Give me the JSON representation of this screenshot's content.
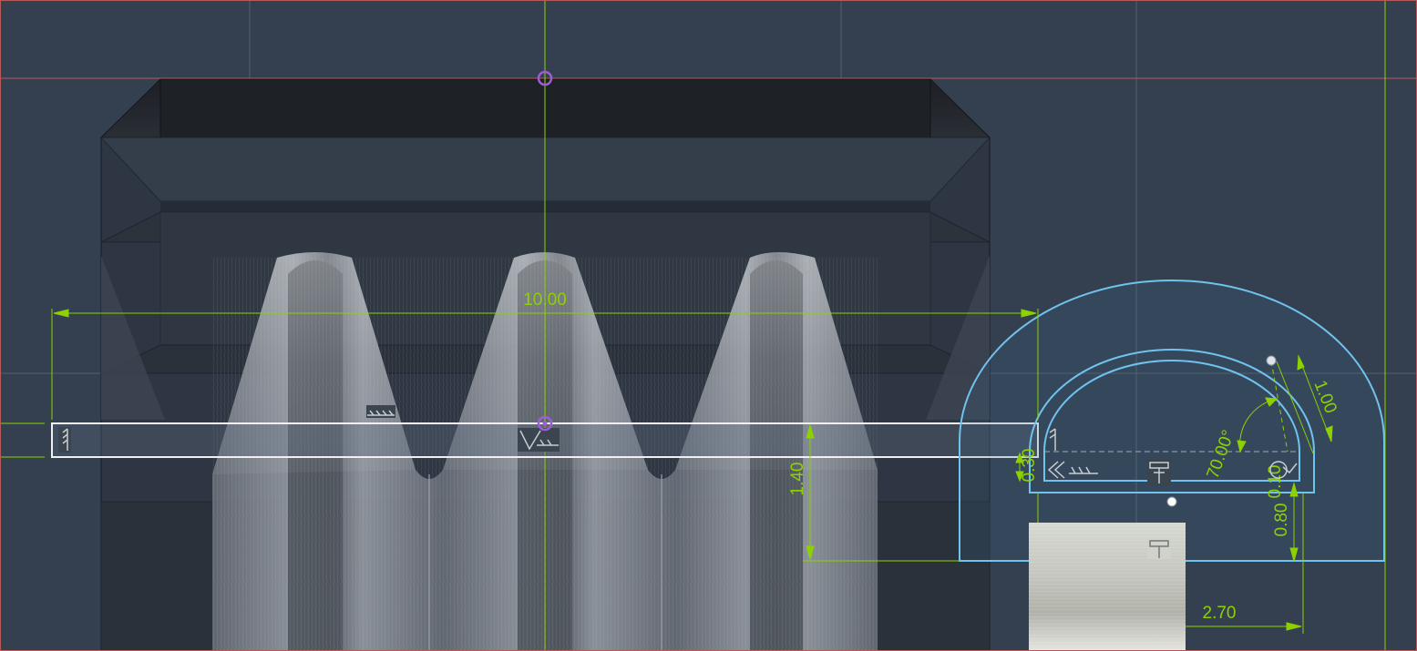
{
  "viewport": {
    "background": "#34404f",
    "frame_color": "#b85a5a"
  },
  "colors": {
    "dimension": "#8dd100",
    "sketch_profile": "#6fc3ee",
    "selected_profile": "#f0f0f0",
    "point_marker": "#a05cd6",
    "grid": "#55616f"
  },
  "dimensions": {
    "overall_width": "10.00",
    "tooth_depth": "1.40",
    "small_offset": "0.30",
    "radius": "1.00",
    "angle": "70.00°",
    "clearance": "0.10",
    "height": "0.80",
    "width": "2.70"
  },
  "constraint_icons": [
    "vertical-constraint-icon",
    "horizontal-constraint-icon",
    "coincident-constraint-icon",
    "tangent-constraint-icon",
    "perpendicular-constraint-icon"
  ]
}
